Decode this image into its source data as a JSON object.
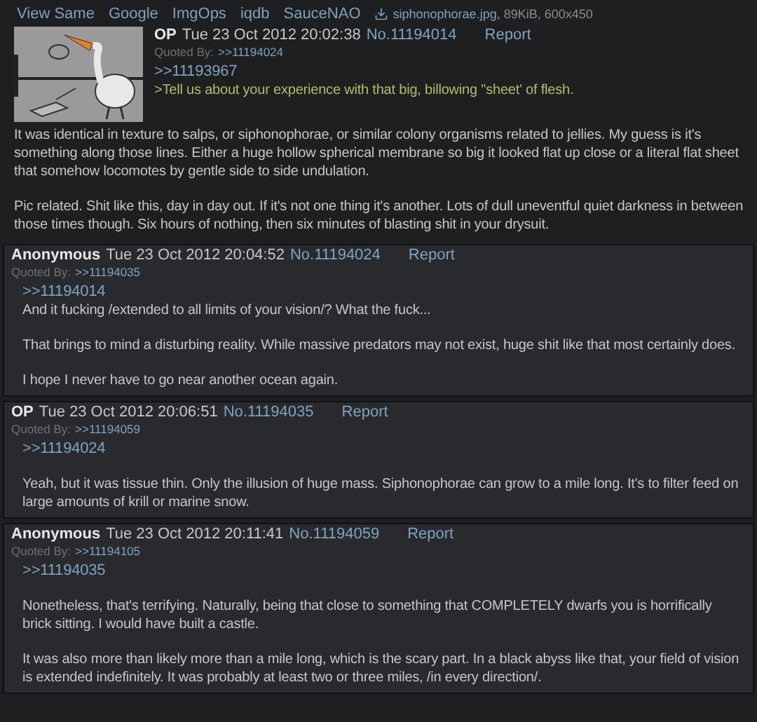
{
  "toolbar": {
    "links": [
      "View Same",
      "Google",
      "ImgOps",
      "iqdb",
      "SauceNAO"
    ],
    "file": {
      "name": "siphonophorae.jpg",
      "info": ", 89KiB, 600x450"
    }
  },
  "posts": [
    {
      "kind": "op",
      "name": "OP",
      "date": "Tue 23 Oct 2012 20:02:38",
      "number": "No.11194014",
      "report": "Report",
      "quoted_label": "Quoted By:",
      "quoted_by": ">>11194024",
      "paragraphs": [
        [
          {
            "kind": "quotelink",
            "text": ">>11193967"
          },
          {
            "kind": "greentext",
            "text": ">Tell us about your experience with that big, billowing \"sheet' of flesh."
          }
        ],
        [
          {
            "kind": "text",
            "text": "It was identical in texture to salps, or siphonophorae, or similar colony organisms related to jellies. My guess is it's something along those lines. Either a huge hollow spherical membrane so big it looked flat up close or a literal flat sheet that somehow locomotes by gentle side to side undulation."
          }
        ],
        [
          {
            "kind": "text",
            "text": "Pic related. Shit like this, day in day out. If it's not one thing it's another. Lots of dull uneventful quiet darkness in between those times though. Six hours of nothing, then six minutes of blasting shit in your drysuit."
          }
        ]
      ]
    },
    {
      "kind": "reply",
      "name": "Anonymous",
      "date": "Tue 23 Oct 2012 20:04:52",
      "number": "No.11194024",
      "report": "Report",
      "quoted_label": "Quoted By:",
      "quoted_by": ">>11194035",
      "paragraphs": [
        [
          {
            "kind": "quotelink",
            "text": ">>11194014"
          },
          {
            "kind": "text",
            "text": "And it fucking /extended to all limits of your vision/? What the fuck..."
          }
        ],
        [
          {
            "kind": "text",
            "text": "That brings to mind a disturbing reality. While massive predators may not exist, huge shit like that most certainly does."
          }
        ],
        [
          {
            "kind": "text",
            "text": "I hope I never have to go near another ocean again."
          }
        ]
      ]
    },
    {
      "kind": "reply",
      "name": "OP",
      "date": "Tue 23 Oct 2012 20:06:51",
      "number": "No.11194035",
      "report": "Report",
      "quoted_label": "Quoted By:",
      "quoted_by": ">>11194059",
      "paragraphs": [
        [
          {
            "kind": "quotelink",
            "text": ">>11194024"
          }
        ],
        [
          {
            "kind": "text",
            "text": "Yeah, but it was tissue thin. Only the illusion of huge mass. Siphonophorae can grow to a mile long. It's to filter feed on large amounts of krill or marine snow."
          }
        ]
      ]
    },
    {
      "kind": "reply",
      "name": "Anonymous",
      "date": "Tue 23 Oct 2012 20:11:41",
      "number": "No.11194059",
      "report": "Report",
      "quoted_label": "Quoted By:",
      "quoted_by": ">>11194105",
      "paragraphs": [
        [
          {
            "kind": "quotelink",
            "text": ">>11194035"
          }
        ],
        [
          {
            "kind": "text",
            "text": "Nonetheless, that's terrifying. Naturally, being that close to something that COMPLETELY dwarfs you is horrifically brick sitting. I would have built a castle."
          }
        ],
        [
          {
            "kind": "text",
            "text": "It was also more than likely more than a mile long, which is the scary part. In a black abyss like that, your field of vision is extended indefinitely. It was probably at least two or three miles, /in every direction/."
          }
        ]
      ]
    }
  ]
}
